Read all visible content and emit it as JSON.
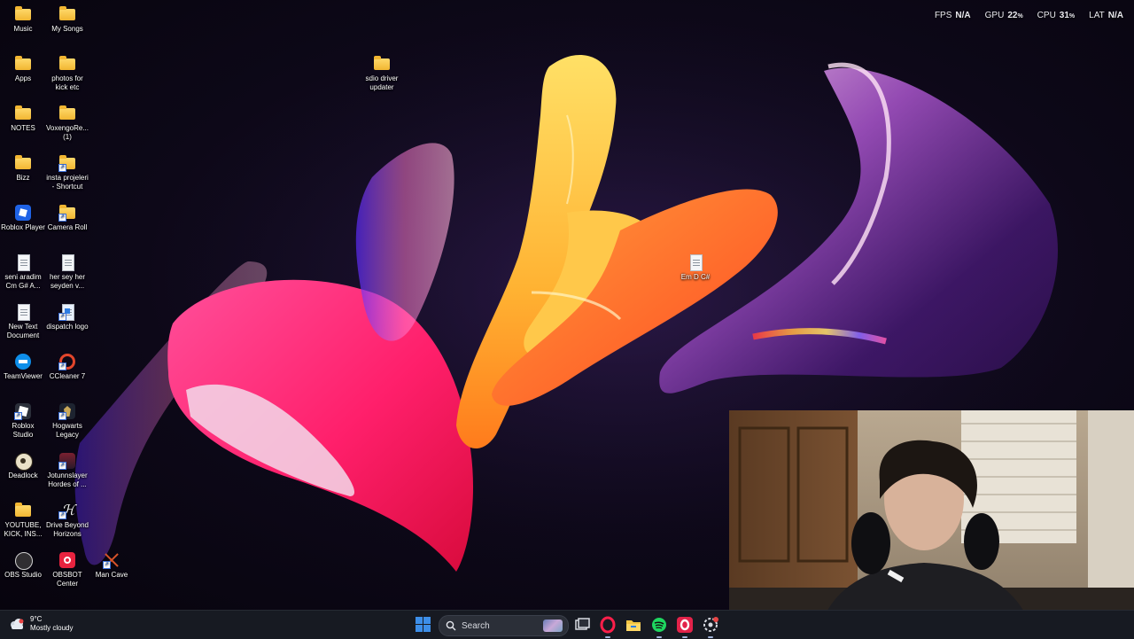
{
  "performance": {
    "fps_label": "FPS",
    "fps_value": "N/A",
    "gpu_label": "GPU",
    "gpu_value": "22",
    "gpu_unit": "%",
    "cpu_label": "CPU",
    "cpu_value": "31",
    "cpu_unit": "%",
    "lat_label": "LAT",
    "lat_value": "N/A"
  },
  "desktop_icons": [
    {
      "label_1": "Music",
      "label_2": "",
      "icon": "folder-icon"
    },
    {
      "label_1": "My Songs",
      "label_2": "",
      "icon": "folder-icon"
    },
    {
      "label_1": "Apps",
      "label_2": "",
      "icon": "folder-icon"
    },
    {
      "label_1": "photos for",
      "label_2": "kick etc",
      "icon": "folder-icon"
    },
    {
      "label_1": "NOTES",
      "label_2": "",
      "icon": "folder-icon"
    },
    {
      "label_1": "VoxengoRe...",
      "label_2": "(1)",
      "icon": "folder-icon"
    },
    {
      "label_1": "Bizz",
      "label_2": "",
      "icon": "folder-icon"
    },
    {
      "label_1": "insta projeleri",
      "label_2": "- Shortcut",
      "icon": "folder-shortcut-icon"
    },
    {
      "label_1": "Roblox Player",
      "label_2": "",
      "icon": "roblox-player-icon"
    },
    {
      "label_1": "Camera Roll",
      "label_2": "",
      "icon": "folder-shortcut-icon"
    },
    {
      "label_1": "seni aradim",
      "label_2": "Cm G# A...",
      "icon": "text-document-icon"
    },
    {
      "label_1": "her sey her",
      "label_2": "seyden v...",
      "icon": "text-document-icon"
    },
    {
      "label_1": "New Text",
      "label_2": "Document",
      "icon": "text-document-icon"
    },
    {
      "label_1": "dispatch logo",
      "label_2": "",
      "icon": "image-shortcut-icon"
    },
    {
      "label_1": "TeamViewer",
      "label_2": "",
      "icon": "teamviewer-icon"
    },
    {
      "label_1": "CCleaner 7",
      "label_2": "",
      "icon": "ccleaner-icon"
    },
    {
      "label_1": "Roblox",
      "label_2": "Studio",
      "icon": "roblox-studio-icon"
    },
    {
      "label_1": "Hogwarts",
      "label_2": "Legacy",
      "icon": "hogwarts-legacy-icon"
    },
    {
      "label_1": "Deadlock",
      "label_2": "",
      "icon": "deadlock-icon"
    },
    {
      "label_1": "Jotunnslayer",
      "label_2": "Hordes of ...",
      "icon": "jotunnslayer-icon"
    },
    {
      "label_1": "YOUTUBE,",
      "label_2": "KICK, INS...",
      "icon": "folder-icon"
    },
    {
      "label_1": "Drive Beyond",
      "label_2": "Horizons",
      "icon": "drive-beyond-horizons-icon"
    },
    {
      "label_1": "OBS Studio",
      "label_2": "",
      "icon": "obs-studio-icon"
    },
    {
      "label_1": "OBSBOT",
      "label_2": "Center",
      "icon": "obsbot-center-icon"
    },
    {
      "label_1": "Man Cave",
      "label_2": "",
      "icon": "man-cave-icon"
    },
    {
      "label_1": "sdio driver",
      "label_2": "updater",
      "icon": "folder-icon"
    },
    {
      "label_1": "Em D C#",
      "label_2": "",
      "icon": "text-document-icon"
    }
  ],
  "taskbar": {
    "weather_temp": "9°C",
    "weather_desc": "Mostly cloudy",
    "search_placeholder": "Search",
    "apps": [
      "task-view-icon",
      "opera-gx-icon",
      "file-explorer-icon",
      "spotify-icon",
      "opera-icon",
      "steelseries-icon"
    ]
  },
  "colors": {
    "taskbar_bg": "#171a22",
    "accent_blue": "#3d8ee8",
    "wallpaper_pink": "#ff2d7a",
    "wallpaper_orange": "#ff7a2a",
    "wallpaper_yellow": "#ffd24a"
  }
}
